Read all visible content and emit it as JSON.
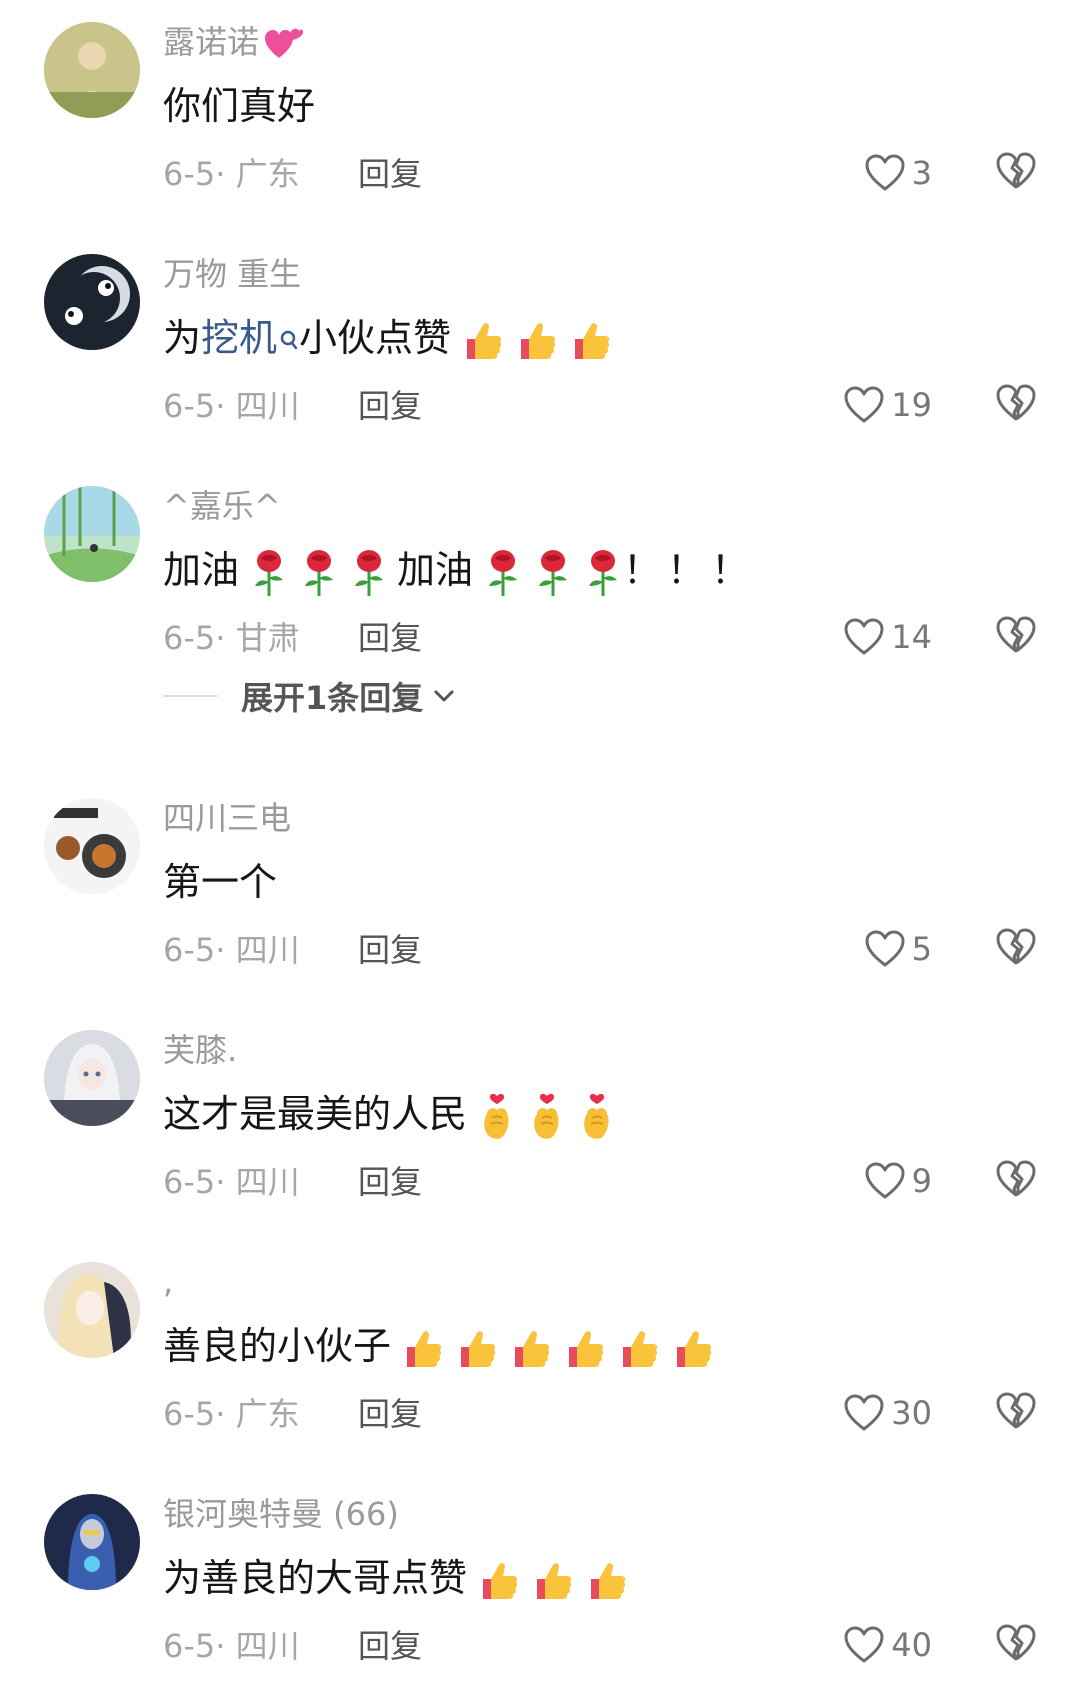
{
  "comments": [
    {
      "username": "露诺诺",
      "text": "你们真好",
      "date": "6-5",
      "location": "广东",
      "reply": "回复",
      "likes": "3",
      "username_emoji": "💕"
    },
    {
      "username": "万物 重生",
      "text_prefix": "为",
      "text_link": "挖机",
      "text_suffix": "小伙点赞",
      "date": "6-5",
      "location": "四川",
      "reply": "回复",
      "likes": "19"
    },
    {
      "username": "^嘉乐^",
      "text_a": "加油",
      "text_b": "加油",
      "text_c": "！！！",
      "date": "6-5",
      "location": "甘肃",
      "reply": "回复",
      "likes": "14",
      "expand": "展开1条回复"
    },
    {
      "username": "四川三电",
      "text": "第一个",
      "date": "6-5",
      "location": "四川",
      "reply": "回复",
      "likes": "5"
    },
    {
      "username": "芙膝.",
      "text": "这才是最美的人民",
      "date": "6-5",
      "location": "四川",
      "reply": "回复",
      "likes": "9"
    },
    {
      "username": ",",
      "text": "善良的小伙子",
      "date": "6-5",
      "location": "广东",
      "reply": "回复",
      "likes": "30"
    },
    {
      "username": "银河奥特曼 (66)",
      "text": "为善良的大哥点赞",
      "date": "6-5",
      "location": "四川",
      "reply": "回复",
      "likes": "40"
    }
  ],
  "icons": {
    "like": "heart-outline-icon",
    "dislike": "broken-heart-icon",
    "thumbs_up": "thumbs-up-emoji",
    "rose": "rose-emoji",
    "finger_heart": "finger-heart-emoji"
  },
  "colors": {
    "text": "#161616",
    "secondary": "#9a9a9a",
    "link": "#3a5a8c"
  }
}
